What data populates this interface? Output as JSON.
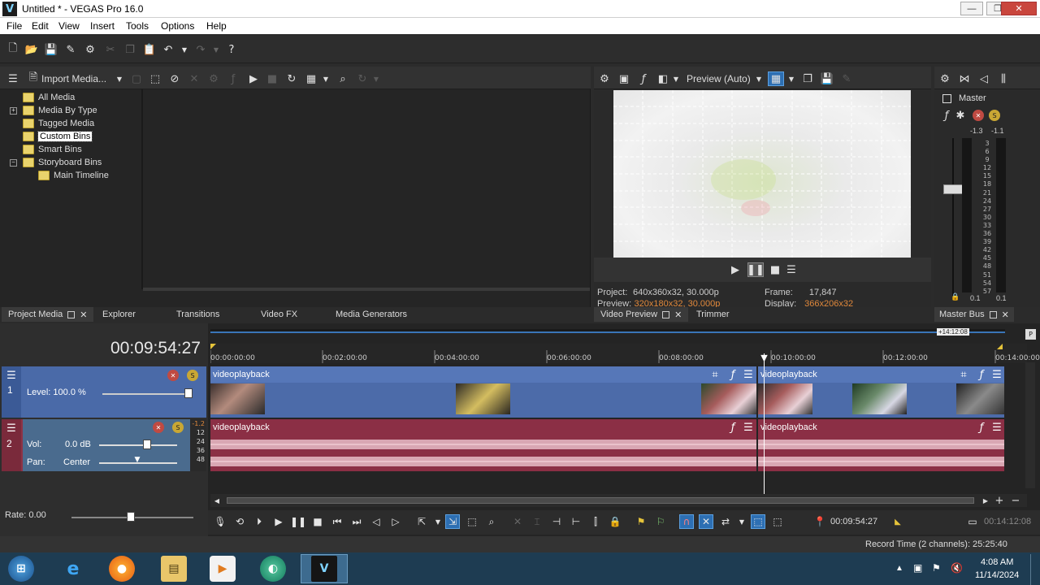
{
  "window": {
    "title": "Untitled * - VEGAS Pro 16.0",
    "app_icon_letter": "V"
  },
  "menu": [
    "File",
    "Edit",
    "View",
    "Insert",
    "Tools",
    "Options",
    "Help"
  ],
  "media_panel": {
    "import_label": "Import Media...",
    "tree": [
      "All Media",
      "Media By Type",
      "Tagged Media",
      "Custom Bins",
      "Smart Bins",
      "Storyboard Bins",
      "Main Timeline"
    ],
    "tabs": [
      "Project Media",
      "Explorer",
      "Transitions",
      "Video FX",
      "Media Generators"
    ]
  },
  "preview": {
    "mode_label": "Preview (Auto)",
    "project_label": "Project:",
    "project_value": "640x360x32, 30.000p",
    "preview_label": "Preview:",
    "preview_value": "320x180x32, 30.000p",
    "frame_label": "Frame:",
    "frame_value": "17,847",
    "display_label": "Display:",
    "display_value": "366x206x32",
    "tabs": [
      "Video Preview",
      "Trimmer"
    ]
  },
  "master": {
    "label": "Master",
    "left_peak": "-1.3",
    "right_peak": "-1.1",
    "scale": [
      "3",
      "6",
      "9",
      "12",
      "15",
      "18",
      "21",
      "24",
      "27",
      "30",
      "33",
      "36",
      "39",
      "42",
      "45",
      "48",
      "51",
      "54",
      "57"
    ],
    "bottom_left": "0.1",
    "bottom_right": "0.1",
    "tab": "Master Bus"
  },
  "timeline": {
    "timecode": "00:09:54:27",
    "end_marker": "+14:12:08",
    "ruler": [
      "00:00:00:00",
      "00:02:00:00",
      "00:04:00:00",
      "00:06:00:00",
      "00:08:00:00",
      "00:10:00:00",
      "00:12:00:00",
      "00:14:00:00"
    ],
    "video_track": {
      "number": "1",
      "level_label": "Level: 100.0 %",
      "clip1": "videoplayback",
      "clip2": "videoplayback"
    },
    "audio_track": {
      "number": "2",
      "vol_label": "Vol:",
      "vol_value": "0.0 dB",
      "pan_label": "Pan:",
      "pan_value": "Center",
      "meter": [
        "-1.2",
        "12",
        "24",
        "36",
        "48"
      ],
      "clip1": "videoplayback",
      "clip2": "videoplayback"
    },
    "rate": "Rate: 0.00",
    "cursor_time": "00:09:54:27",
    "length_time": "00:14:12:08"
  },
  "status": {
    "record_time": "Record Time (2 channels): 25:25:40"
  },
  "taskbar": {
    "time": "4:08 AM",
    "date": "11/14/2024"
  },
  "colors": {
    "video": "#4c6ba9",
    "audio": "#8b2f45",
    "accent": "#2d6fb3"
  }
}
